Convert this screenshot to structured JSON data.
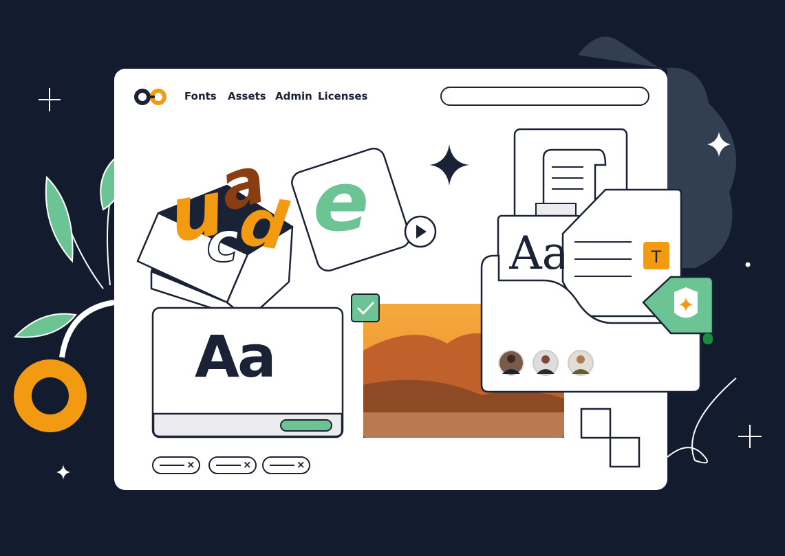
{
  "colors": {
    "background": "#131c2e",
    "card": "#ffffff",
    "outline": "#1a2236",
    "orange": "#f29a12",
    "green": "#6cc495",
    "brown": "#8b3d12",
    "blob": "#323e52"
  },
  "nav": {
    "logo": "logo-icon",
    "items": [
      {
        "label": "Fonts"
      },
      {
        "label": "Assets"
      },
      {
        "label": "Admin"
      },
      {
        "label": "Licenses"
      }
    ]
  },
  "search": {
    "placeholder": ""
  },
  "letters": {
    "u": "u",
    "a": "a",
    "c": "c",
    "d": "d",
    "e": "e"
  },
  "font_card": {
    "sample": "Aa"
  },
  "folder": {
    "sample": "Aa",
    "text_tool": "T",
    "avatars": 3
  },
  "icons": [
    "play-icon",
    "check-icon",
    "text-tool-icon",
    "shield-icon",
    "sparkle-icon",
    "plus-sparkle-icon"
  ],
  "tags": [
    {
      "remove": "×"
    },
    {
      "remove": "×"
    },
    {
      "remove": "×"
    }
  ]
}
